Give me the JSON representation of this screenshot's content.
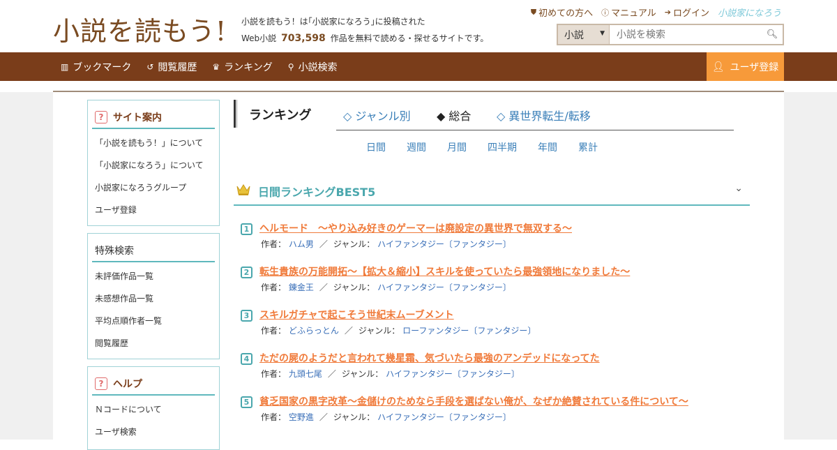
{
  "header": {
    "logo": "小説を読もう!",
    "tagline_line1": "小説を読もう！は｢小説家になろう｣に投稿された",
    "tagline_prefix": "Web小説",
    "novel_count": "703,598",
    "tagline_suffix": "作品を無料で読める・探せるサイトです。",
    "links": [
      {
        "label": "初めての方へ",
        "icon": "shield-icon"
      },
      {
        "label": "マニュアル",
        "icon": "question-icon"
      },
      {
        "label": "ログイン",
        "icon": "login-icon"
      }
    ],
    "narou_logo": "小説家になろう",
    "search": {
      "select_value": "小説",
      "placeholder": "小説を検索"
    }
  },
  "nav": {
    "items": [
      {
        "label": "ブックマーク",
        "icon": "bookmark-icon"
      },
      {
        "label": "閲覧履歴",
        "icon": "history-icon"
      },
      {
        "label": "ランキング",
        "icon": "crown-icon"
      },
      {
        "label": "小説検索",
        "icon": "search-icon"
      }
    ],
    "register": "ユーザ登録"
  },
  "sidebar": {
    "guide": {
      "title": "サイト案内",
      "items": [
        "「小説を読もう！」について",
        "「小説家になろう」について",
        "小説家になろうグループ",
        "ユーザ登録"
      ]
    },
    "special": {
      "title": "特殊検索",
      "items": [
        "未評価作品一覧",
        "未感想作品一覧",
        "平均点順作者一覧",
        "閲覧履歴"
      ]
    },
    "help": {
      "title": "ヘルプ",
      "items": [
        "Ｎコードについて",
        "ユーザ検索"
      ]
    }
  },
  "content": {
    "heading": "ランキング",
    "tabs": [
      {
        "label": "◇ ジャンル別",
        "active": false
      },
      {
        "label": "◆ 総合",
        "active": true
      },
      {
        "label": "◇ 異世界転生/転移",
        "active": false
      }
    ],
    "periods": [
      "日間",
      "週間",
      "月間",
      "四半期",
      "年間",
      "累計"
    ],
    "best_title": "日間ランキングBEST5",
    "author_label": "作者：",
    "genre_label": "ジャンル：",
    "rankings": [
      {
        "num": "1",
        "title": "ヘルモード　～やり込み好きのゲーマーは廃設定の異世界で無双する～",
        "author": "ハム男",
        "genre": "ハイファンタジー〔ファンタジー〕"
      },
      {
        "num": "2",
        "title": "転生貴族の万能開拓～【拡大＆縮小】スキルを使っていたら最強領地になりました～",
        "author": "錬金王",
        "genre": "ハイファンタジー〔ファンタジー〕"
      },
      {
        "num": "3",
        "title": "スキルガチャで起こそう世紀末ムーブメント",
        "author": "どふらっとん",
        "genre": "ローファンタジー〔ファンタジー〕"
      },
      {
        "num": "4",
        "title": "ただの屍のようだと言われて幾星霜、気づいたら最強のアンデッドになってた",
        "author": "九頭七尾",
        "genre": "ハイファンタジー〔ファンタジー〕"
      },
      {
        "num": "5",
        "title": "貧乏国家の黒字改革〜金儲けのためなら手段を選ばない俺が、なぜか絶賛されている件について〜",
        "author": "空野進",
        "genre": "ハイファンタジー〔ファンタジー〕"
      }
    ]
  }
}
